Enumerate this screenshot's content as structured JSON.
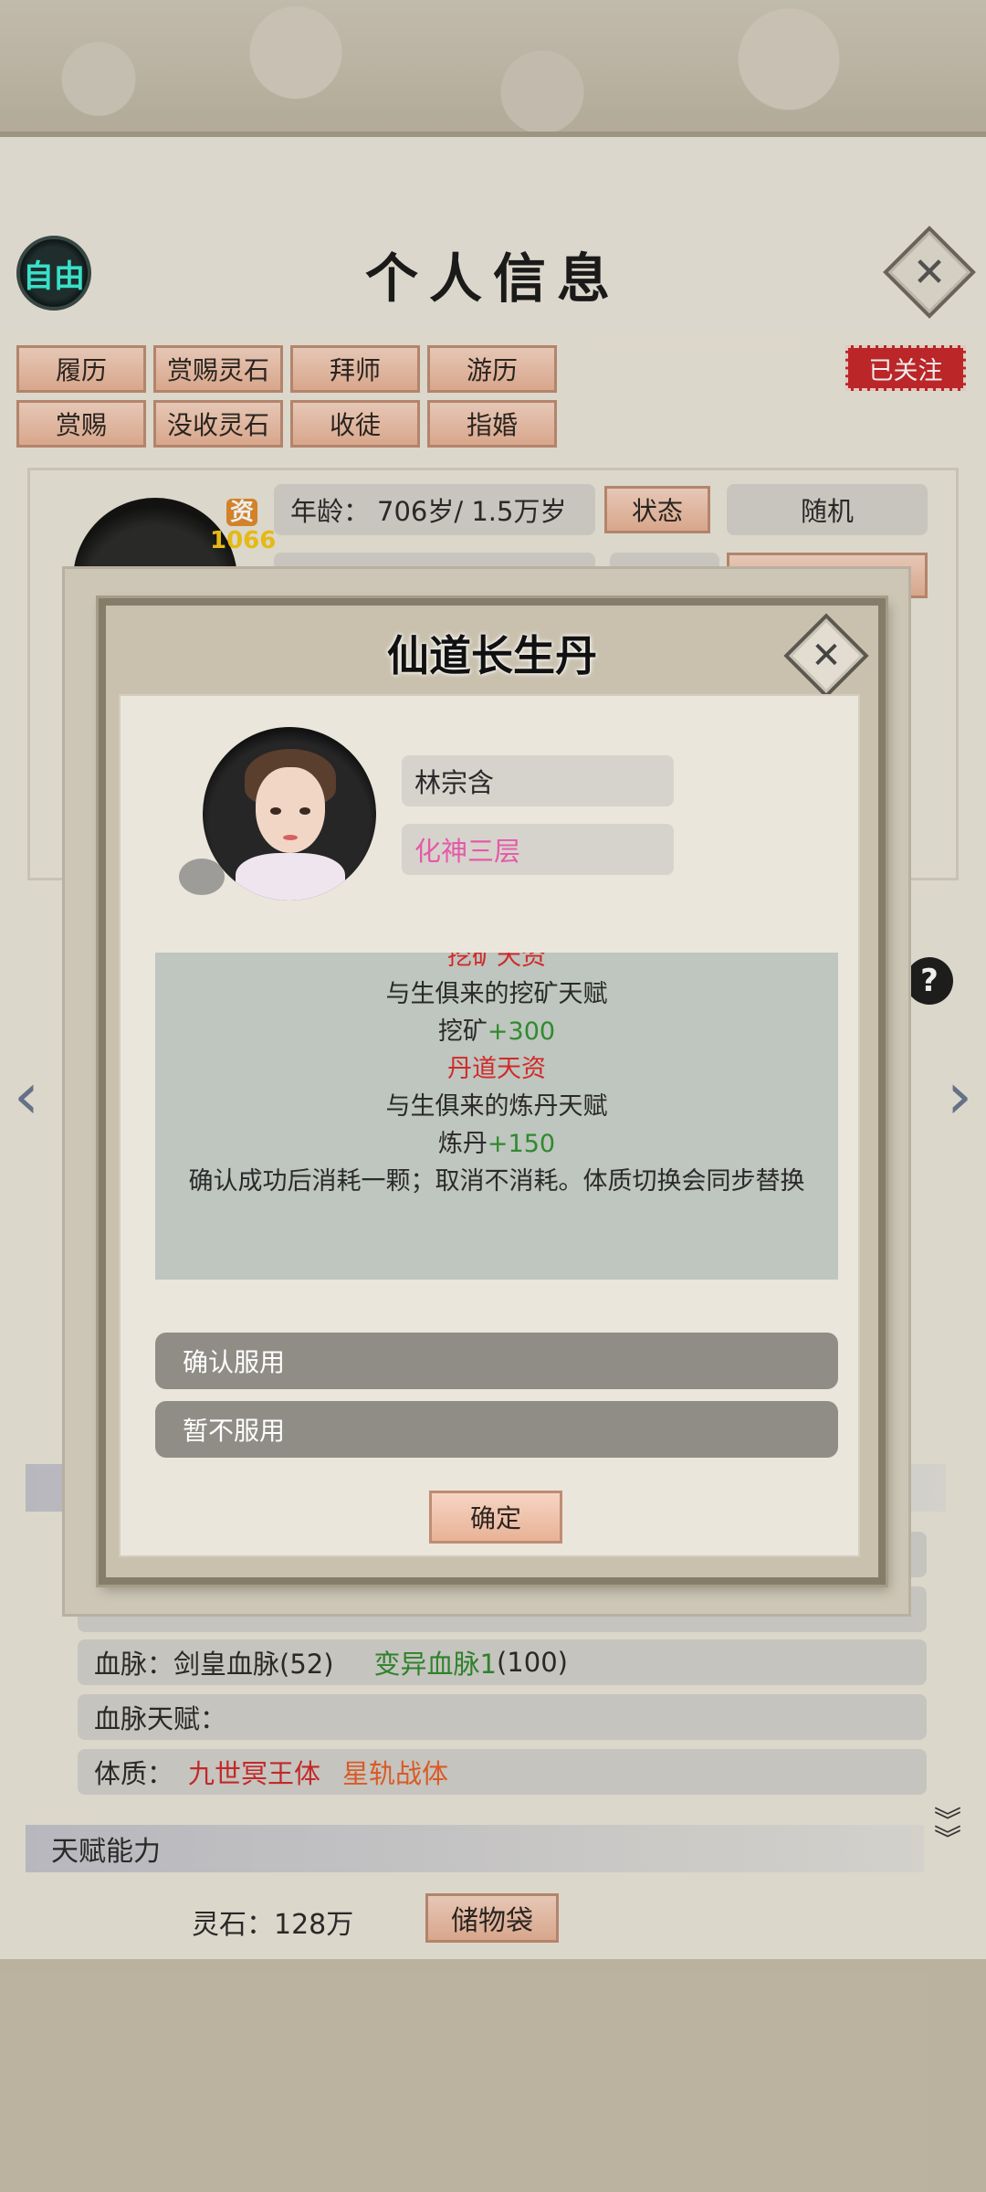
{
  "header": {
    "free_badge": "自由",
    "title": "个人信息",
    "close_icon": "close-icon"
  },
  "actions": {
    "row1": [
      "履历",
      "赏赐灵石",
      "拜师",
      "游历"
    ],
    "row2": [
      "赏赐",
      "没收灵石",
      "收徒",
      "指婚"
    ],
    "follow": "已关注"
  },
  "character": {
    "aptitude_label": "资",
    "aptitude_value": "1066",
    "age_label": "年龄：",
    "age_value": "706岁/ 1.5万岁",
    "status_button": "状态",
    "random_button": "随机"
  },
  "lower": {
    "bloodline": "血脉：剑皇血脉(52)",
    "bloodline_variant": "变异血脉1",
    "bloodline_variant_value": "(100)",
    "bloodline_talent": "血脉天赋：",
    "physique_label": "体质：",
    "physique_1": "九世冥王体",
    "physique_2": "星轨战体",
    "talent_section": "天赋能力",
    "spirit_stone": "灵石：128万",
    "bag_button": "储物袋"
  },
  "modal": {
    "title": "仙道长生丹",
    "name": "林宗含",
    "realm": "化神三层",
    "description": [
      {
        "text": "挖矿天资",
        "color": "red"
      },
      {
        "text": "与生俱来的挖矿天赋",
        "color": "normal"
      },
      {
        "text": "挖矿",
        "bonus": "+300"
      },
      {
        "text": "丹道天资",
        "color": "red"
      },
      {
        "text": "与生俱来的炼丹天赋",
        "color": "normal"
      },
      {
        "text": "炼丹",
        "bonus": "+150"
      },
      {
        "text": "确认成功后消耗一颗；取消不消耗。体质切换会同步替换",
        "color": "normal"
      }
    ],
    "option_confirm": "确认服用",
    "option_cancel": "暂不服用",
    "ok_button": "确定"
  },
  "colors": {
    "accent_peach": "#e8b296",
    "follow_red": "#c8262a",
    "realm_pink": "#e45aa8",
    "talent_red": "#d02a2a",
    "bonus_green": "#2f8a2f"
  }
}
